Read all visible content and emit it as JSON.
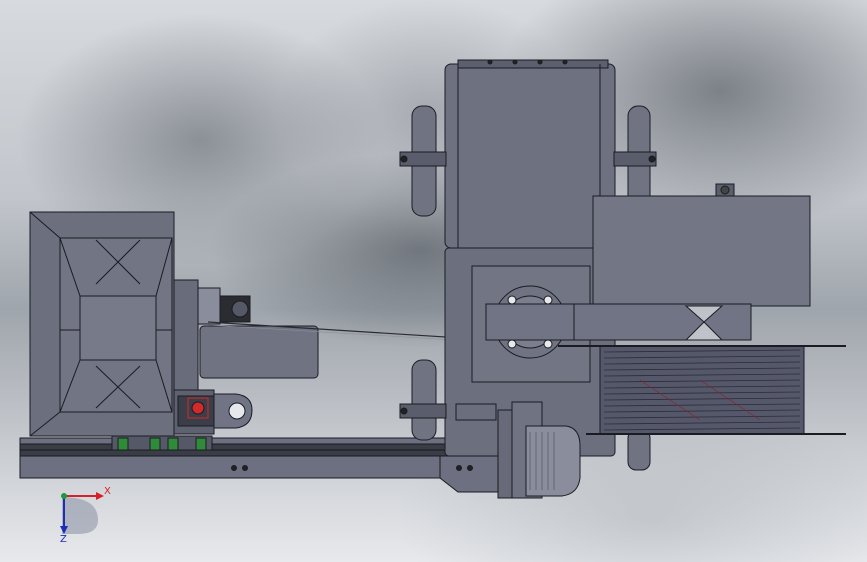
{
  "view": {
    "triad": {
      "x_label": "X",
      "z_label": "Z",
      "x_color": "#d8202a",
      "z_color": "#1c2db8",
      "origin_color": "#1f9a3a"
    }
  },
  "colors": {
    "body": "#6f7382",
    "body_dark": "#4f5260",
    "body_light": "#858998",
    "outline": "#1a1c22",
    "rail": "#2f3138",
    "green_accent": "#2f8a3a",
    "red_accent": "#d12a2a"
  }
}
